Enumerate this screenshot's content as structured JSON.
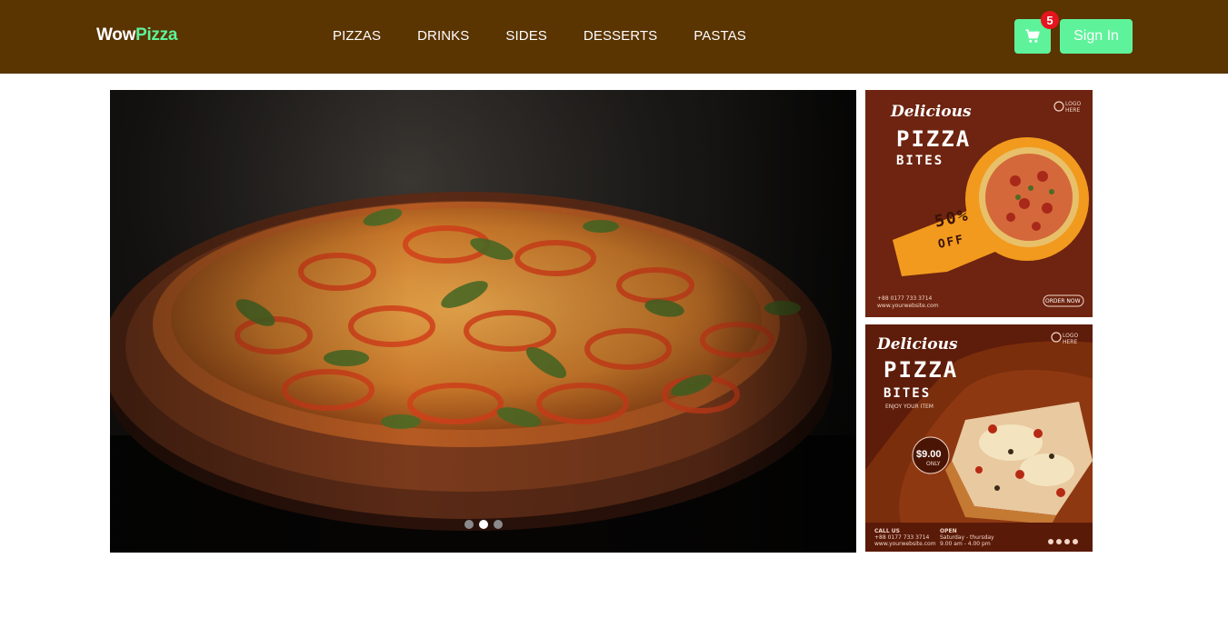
{
  "header": {
    "logo_part1": "Wow",
    "logo_part2": "Pizza",
    "nav": [
      "PIZZAS",
      "DRINKS",
      "SIDES",
      "DESSERTS",
      "PASTAS"
    ],
    "cart_count": "5",
    "signin_label": "Sign In"
  },
  "carousel": {
    "slides": 3,
    "active_index": 1
  },
  "promo1": {
    "line1": "Delicious",
    "line2": "PIZZA",
    "line3": "BITES",
    "discount": "50%",
    "discount_sub": "OFF",
    "logo_text": "LOGO HERE",
    "phone": "+88 0177 733 3714",
    "website": "www.yourwebsite.com",
    "cta": "ORDER NOW"
  },
  "promo2": {
    "line1": "Delicious",
    "line2": "PIZZA",
    "line3": "BITES",
    "tagline": "ENJOY YOUR ITEM",
    "price": "$9.00",
    "price_sub": "ONLY",
    "logo_text": "LOGO HERE",
    "call_label": "CALL US",
    "phone": "+88 0177 733 3714",
    "website": "www.yourwebsite.com",
    "open_label": "OPEN",
    "open_days": "Saturday - thursday",
    "open_hours": "9.00 am - 4.00 pm"
  },
  "colors": {
    "navbar": "#5a3401",
    "accent": "#5ef39a",
    "badge": "#e5141e"
  }
}
